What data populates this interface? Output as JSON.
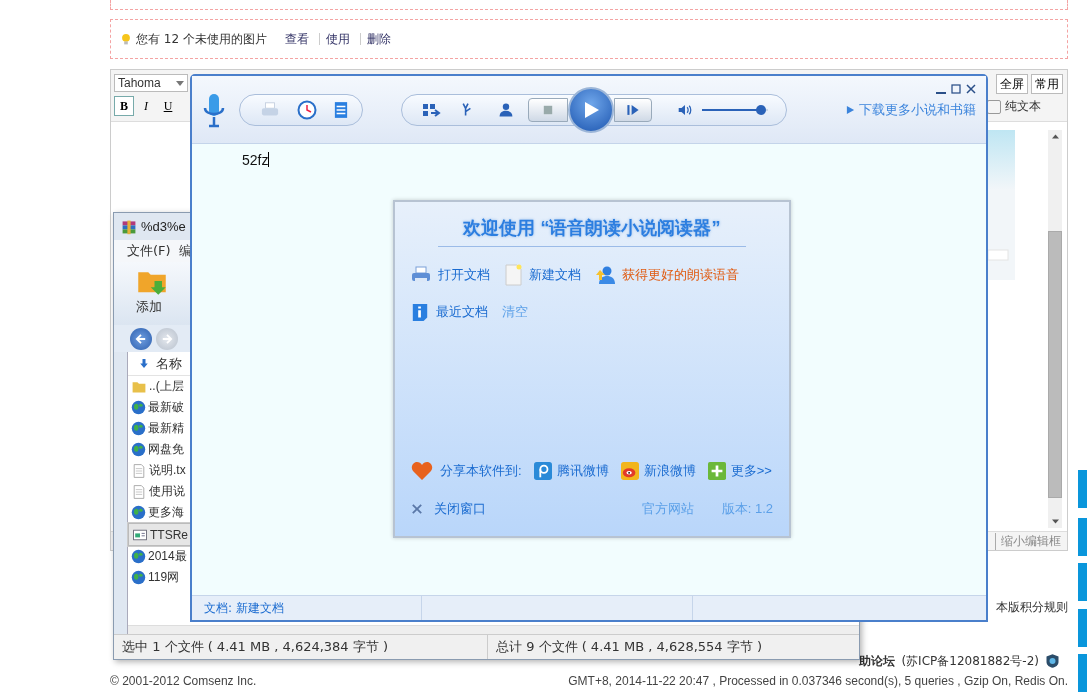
{
  "notice": {
    "text": "您有 12 个未使用的图片",
    "links": [
      "查看",
      "使用",
      "删除"
    ]
  },
  "editor": {
    "font": "Tahoma",
    "format_buttons": [
      "B",
      "I",
      "U"
    ],
    "right_buttons": [
      "全屏",
      "常用"
    ],
    "plain_text": {
      "label": "纯文本",
      "checked": false
    },
    "collapse_link": "缩小编辑框"
  },
  "page_link": "本版积分规则",
  "footer": {
    "site": "助论坛",
    "icp": "(苏ICP备12081882号-2)",
    "copyright": "© 2001-2012 Comsenz Inc.",
    "stats": "GMT+8, 2014-11-22 20:47 , Processed in 0.037346 second(s), 5 queries , Gzip On, Redis On."
  },
  "archive": {
    "title": "%d3%e",
    "menu": [
      "文件(F)",
      "编"
    ],
    "tool": "添加",
    "column": "名称",
    "files": [
      {
        "name": "..(上层",
        "kind": "folder",
        "selected": false
      },
      {
        "name": "最新破",
        "kind": "web",
        "selected": false
      },
      {
        "name": "最新精",
        "kind": "web",
        "selected": false
      },
      {
        "name": "网盘免",
        "kind": "web",
        "selected": false
      },
      {
        "name": "说明.tx",
        "kind": "text",
        "selected": false
      },
      {
        "name": "使用说",
        "kind": "text",
        "selected": false
      },
      {
        "name": "更多海",
        "kind": "web",
        "selected": false
      },
      {
        "name": "TTSRe",
        "kind": "app",
        "selected": true
      },
      {
        "name": "2014最",
        "kind": "web",
        "selected": false
      },
      {
        "name": "119网",
        "kind": "web",
        "selected": false
      }
    ],
    "status": [
      "选中 1 个文件 ( 4.41 MB , 4,624,384 字节 )",
      "总计 9 个文件 ( 4.41 MB , 4,628,554 字节 )"
    ]
  },
  "reader": {
    "volume": {
      "level": 0.9
    },
    "download_link": "下载更多小说和书籍",
    "text": "52fz",
    "status": "文档: 新建文档",
    "dialog": {
      "title": "欢迎使用 “语音朗读小说阅读器”",
      "actions": [
        {
          "label": "打开文档",
          "kind": "printer"
        },
        {
          "label": "新建文档",
          "kind": "page"
        },
        {
          "label": "获得更好的朗读语音",
          "kind": "voice"
        }
      ],
      "recent": {
        "label": "最近文档",
        "clear": "清空"
      },
      "share": {
        "label": "分享本软件到:",
        "targets": [
          {
            "label": "腾讯微博",
            "kind": "tencent"
          },
          {
            "label": "新浪微博",
            "kind": "weibo"
          },
          {
            "label": "更多>>",
            "kind": "more"
          }
        ]
      },
      "close": "关闭窗口",
      "site": "官方网站",
      "version": "版本: 1.2"
    }
  }
}
